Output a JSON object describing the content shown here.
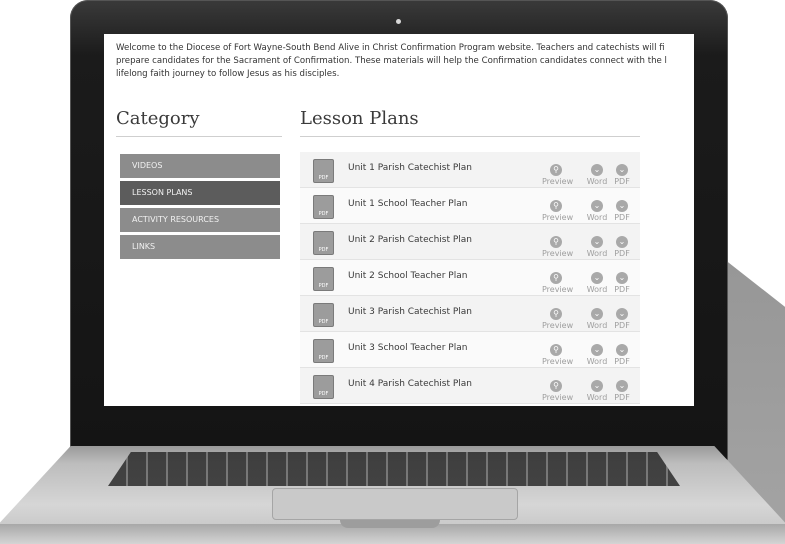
{
  "intro": {
    "line1": "Welcome to the Diocese of Fort Wayne-South Bend Alive in Christ Confirmation Program website. Teachers and catechists will fi",
    "line2": "prepare candidates for the Sacrament of Confirmation. These materials will help the Confirmation candidates connect with the l",
    "line3": "lifelong faith journey to follow Jesus as his disciples."
  },
  "sidebar": {
    "title": "Category",
    "items": [
      {
        "label": "VIDEOS"
      },
      {
        "label": "LESSON PLANS"
      },
      {
        "label": "ACTIVITY RESOURCES"
      },
      {
        "label": "LINKS"
      }
    ],
    "active_item": "LESSON PLANS"
  },
  "lesson_plans": {
    "title": "Lesson Plans",
    "file_icon_text": "PDF",
    "actions": {
      "preview": "Preview",
      "word": "Word",
      "pdf": "PDF"
    },
    "rows": [
      {
        "label": "Unit 1 Parish Catechist Plan"
      },
      {
        "label": "Unit 1 School Teacher Plan"
      },
      {
        "label": "Unit 2 Parish Catechist Plan"
      },
      {
        "label": "Unit 2 School Teacher Plan"
      },
      {
        "label": "Unit 3 Parish Catechist Plan"
      },
      {
        "label": "Unit 3 School Teacher Plan"
      },
      {
        "label": "Unit 4 Parish Catechist Plan"
      }
    ]
  },
  "icons": {
    "file": "pdf-file-icon",
    "preview": "magnifier-icon",
    "word": "chevron-down-circle-icon",
    "pdf": "chevron-down-circle-icon"
  }
}
